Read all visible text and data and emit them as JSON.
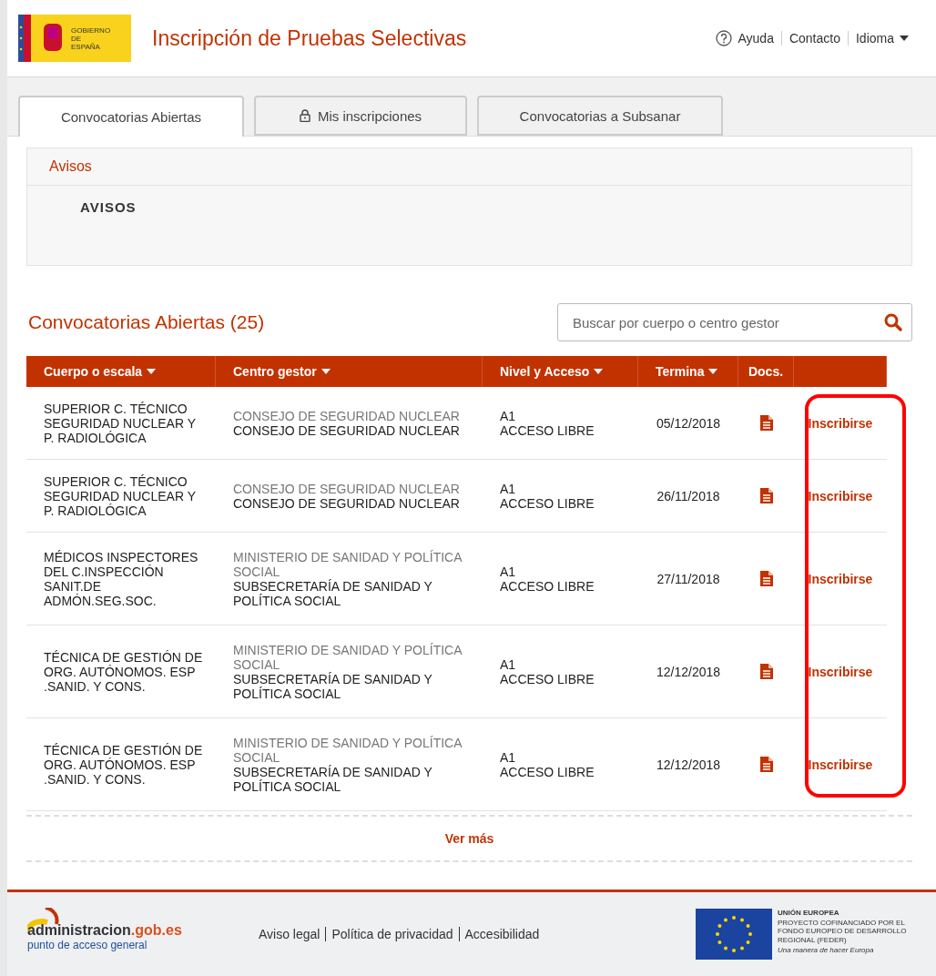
{
  "header": {
    "logo_text": "GOBIERNO DE ESPAÑA",
    "title": "Inscripción de Pruebas Selectivas",
    "links": [
      {
        "label": "Ayuda",
        "kind": "help"
      },
      {
        "label": "Contacto",
        "kind": "plain"
      },
      {
        "label": "Idioma",
        "kind": "dropdown"
      }
    ]
  },
  "tabs": [
    {
      "label": "Convocatorias Abiertas",
      "selected": true,
      "locked": false
    },
    {
      "label": "Mis inscripciones",
      "selected": false,
      "locked": true
    },
    {
      "label": "Convocatorias a Subsanar",
      "selected": false,
      "locked": false
    }
  ],
  "notices": {
    "title": "Avisos",
    "heading": "AVISOS"
  },
  "listing": {
    "title": "Convocatorias Abiertas (25)",
    "search": {
      "placeholder": "Buscar por cuerpo o centro gestor"
    },
    "columns": [
      {
        "label": "Cuerpo o escala",
        "sortable": true
      },
      {
        "label": "Centro gestor",
        "sortable": true
      },
      {
        "label": "Nivel y Acceso",
        "sortable": true
      },
      {
        "label": "Termina",
        "sortable": true
      },
      {
        "label": "Docs.",
        "sortable": false
      },
      {
        "sortable": false
      }
    ],
    "rows": [
      {
        "body": "SUPERIOR C. TÉCNICO SEGURIDAD NUCLEAR Y P. RADIOLÓGICA",
        "ministry": "CONSEJO DE SEGURIDAD NUCLEAR",
        "unit": "CONSEJO DE SEGURIDAD NUCLEAR",
        "level": "A1",
        "access": "ACCESO LIBRE",
        "ends": "05/12/2018",
        "action": "Inscribirse"
      },
      {
        "body": "SUPERIOR C. TÉCNICO SEGURIDAD NUCLEAR Y P. RADIOLÓGICA",
        "ministry": "CONSEJO DE SEGURIDAD NUCLEAR",
        "unit": "CONSEJO DE SEGURIDAD NUCLEAR",
        "level": "A1",
        "access": "ACCESO LIBRE",
        "ends": "26/11/2018",
        "action": "Inscribirse"
      },
      {
        "body": "MÉDICOS INSPECTORES DEL C.INSPECCIÓN SANIT.DE ADMÓN.SEG.SOC.",
        "ministry": "MINISTERIO DE SANIDAD Y POLÍTICA SOCIAL",
        "unit": "SUBSECRETARÍA DE SANIDAD Y POLÍTICA SOCIAL",
        "level": "A1",
        "access": "ACCESO LIBRE",
        "ends": "27/11/2018",
        "action": "Inscribirse"
      },
      {
        "body": "TÉCNICA DE GESTIÓN DE ORG. AUTÓNOMOS. ESP .SANID. Y CONS.",
        "ministry": "MINISTERIO DE SANIDAD Y POLÍTICA SOCIAL",
        "unit": "SUBSECRETARÍA DE SANIDAD Y POLÍTICA SOCIAL",
        "level": "A1",
        "access": "ACCESO LIBRE",
        "ends": "12/12/2018",
        "action": "Inscribirse"
      },
      {
        "body": "TÉCNICA DE GESTIÓN DE ORG. AUTÓNOMOS. ESP .SANID. Y CONS.",
        "ministry": "MINISTERIO DE SANIDAD Y POLÍTICA SOCIAL",
        "unit": "SUBSECRETARÍA DE SANIDAD Y POLÍTICA SOCIAL",
        "level": "A1",
        "access": "ACCESO LIBRE",
        "ends": "12/12/2018",
        "action": "Inscribirse"
      }
    ],
    "more": "Ver más",
    "annotation": {
      "kind": "highlight_box"
    }
  },
  "footer": {
    "logo_name": "administracion",
    "logo_domain": ".gob.es",
    "logo_tagline": "punto de acceso general",
    "links": [
      "Aviso legal",
      "Política de privacidad",
      "Accesibilidad"
    ],
    "eu": {
      "title": "UNIÓN EUROPEA",
      "text": "PROYECTO COFINANCIADO POR EL FONDO EUROPEO DE DESARROLLO REGIONAL (FEDER)",
      "motto": "Una manera de hacer Europa"
    }
  }
}
